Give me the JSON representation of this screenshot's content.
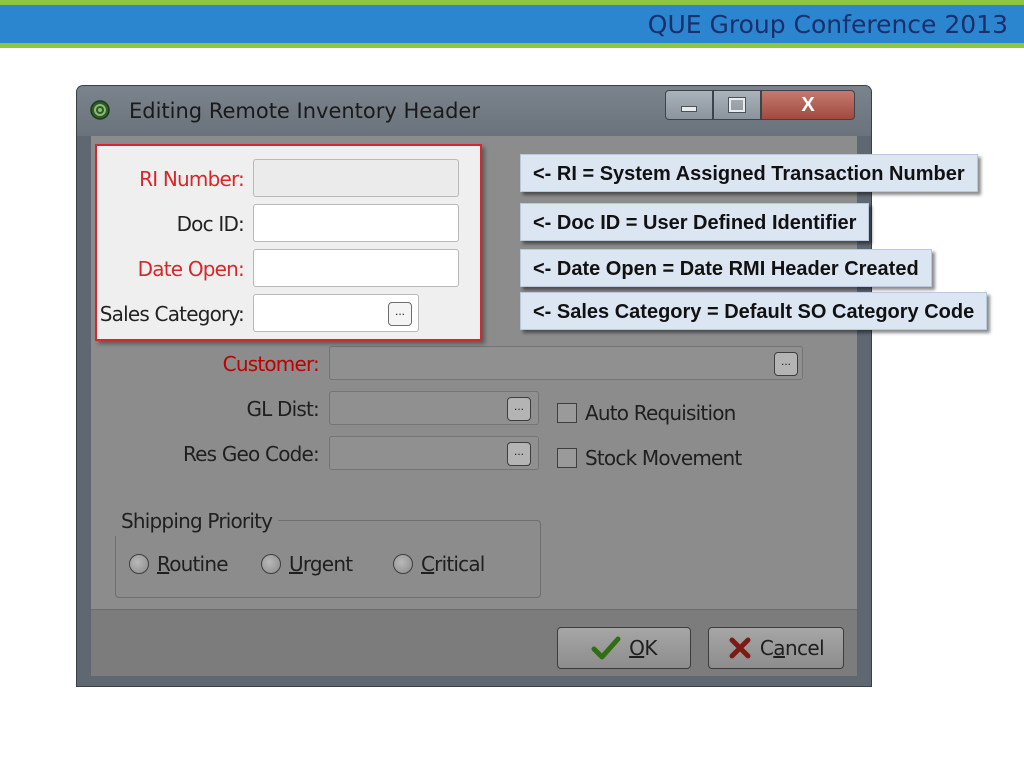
{
  "slide": {
    "title": "QUE Group Conference 2013"
  },
  "window": {
    "title": "Editing Remote Inventory Header",
    "icon": "gear-icon",
    "controls": {
      "minimize": "minimize-icon",
      "maximize": "maximize-icon",
      "close": "X"
    }
  },
  "form": {
    "ri_number": {
      "label": "RI Number:",
      "value": ""
    },
    "doc_id": {
      "label": "Doc ID:",
      "value": ""
    },
    "date_open": {
      "label": "Date Open:",
      "value": ""
    },
    "sales_category": {
      "label": "Sales Category:",
      "value": "",
      "lookup": "..."
    },
    "customer": {
      "label": "Customer:",
      "value": "",
      "lookup": "..."
    },
    "gl_dist": {
      "label": "GL Dist:",
      "value": "",
      "lookup": "..."
    },
    "res_geo_code": {
      "label": "Res Geo Code:",
      "value": "",
      "lookup": "..."
    },
    "auto_requisition": {
      "label": "Auto Requisition",
      "checked": false
    },
    "stock_movement": {
      "label": "Stock Movement",
      "checked": false
    },
    "shipping_priority": {
      "title": "Shipping Priority",
      "options": [
        {
          "hotkey": "R",
          "rest": "outine",
          "selected": false
        },
        {
          "hotkey": "U",
          "rest": "rgent",
          "selected": false
        },
        {
          "hotkey": "C",
          "rest": "ritical",
          "selected": false
        }
      ]
    }
  },
  "buttons": {
    "ok": {
      "hotkey": "O",
      "rest": "K",
      "icon": "checkmark-icon"
    },
    "cancel": {
      "pre": "C",
      "hotkey": "a",
      "rest": "ncel",
      "icon": "x-icon"
    }
  },
  "callouts": [
    "<- RI = System Assigned Transaction Number",
    "<- Doc ID = User Defined Identifier",
    "<- Date Open = Date RMI Header Created",
    "<- Sales Category = Default SO Category Code"
  ],
  "colors": {
    "band_blue": "#2b86cf",
    "band_green": "#8dc63f",
    "required_label": "#d8262d",
    "callout_bg": "#dce6f2"
  }
}
